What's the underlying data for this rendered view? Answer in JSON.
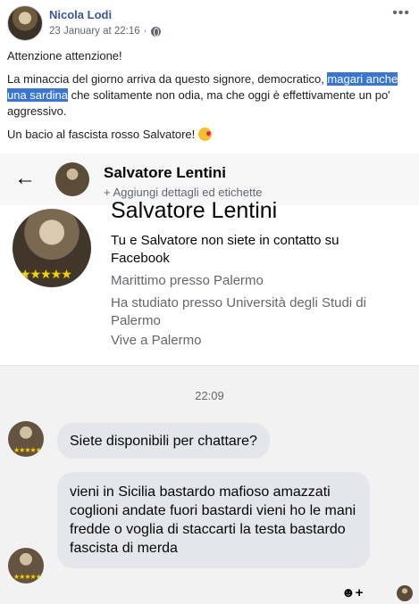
{
  "post": {
    "author": "Nicola Lodi",
    "timestamp": "23 January at 22:16",
    "privacy_icon": "globe-icon",
    "more_icon": "more-options-icon",
    "more_label": "•••",
    "line1": "Attenzione attenzione!",
    "line2_before": "La minaccia del giorno arriva da questo signore, democratico, ",
    "line2_highlight": "magari anche una sardina",
    "line2_after": " che solitamente non odia, ma che oggi è effettivamente un po' aggressivo.",
    "line3": "Un bacio al fascista rosso Salvatore!",
    "line3_emoji": "face-blowing-kiss-emoji"
  },
  "messenger": {
    "back_label": "←",
    "contact_name": "Salvatore Lentini",
    "add_details": "+ Aggiungi dettagli ed etichette",
    "card": {
      "name": "Salvatore Lentini",
      "relationship": "Tu e Salvatore non siete in contatto su Facebook",
      "work": "Marittimo presso Palermo",
      "education": "Ha studiato presso Università degli Studi di Palermo",
      "location": "Vive a Palermo",
      "stars": "★★★★★"
    },
    "time": "22:09",
    "messages": [
      {
        "text": "Siete disponibili per chattare?"
      },
      {
        "text": "vieni in Sicilia bastardo  mafioso amazzati coglioni andate fuori bastardi vieni ho le mani fredde o voglia di staccarti la testa bastardo fascista di merda"
      }
    ],
    "react_label": "☻+"
  },
  "colors": {
    "author_link": "#385898",
    "highlight": "#3875d7",
    "bubble": "#e4e6eb",
    "secondary_text": "#65676b"
  }
}
